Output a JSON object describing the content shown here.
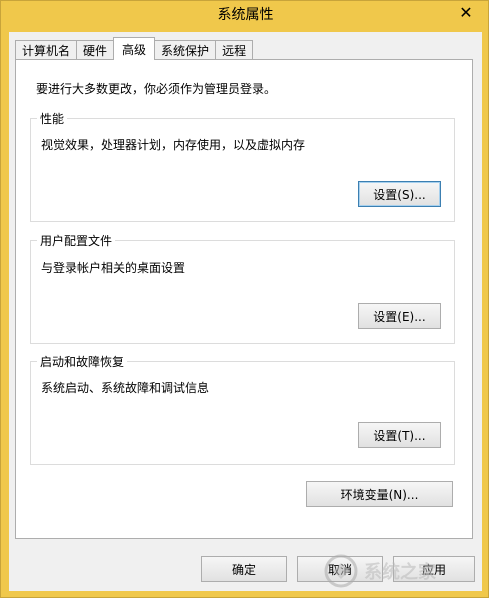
{
  "window": {
    "title": "系统属性",
    "close_glyph": "✕"
  },
  "tabs": [
    {
      "label": "计算机名",
      "active": false
    },
    {
      "label": "硬件",
      "active": false
    },
    {
      "label": "高级",
      "active": true
    },
    {
      "label": "系统保护",
      "active": false
    },
    {
      "label": "远程",
      "active": false
    }
  ],
  "panel": {
    "intro": "要进行大多数更改，你必须作为管理员登录。",
    "performance": {
      "title": "性能",
      "description": "视觉效果，处理器计划，内存使用，以及虚拟内存",
      "button": "设置(S)..."
    },
    "user_profiles": {
      "title": "用户配置文件",
      "description": "与登录帐户相关的桌面设置",
      "button": "设置(E)..."
    },
    "startup_recovery": {
      "title": "启动和故障恢复",
      "description": "系统启动、系统故障和调试信息",
      "button": "设置(T)..."
    },
    "env_button": "环境变量(N)..."
  },
  "footer": {
    "ok": "确定",
    "cancel": "取消",
    "apply": "应用"
  },
  "watermark": {
    "icon": "logo-icon",
    "text": "系统之家"
  },
  "colors": {
    "titlebar": "#f0c84b",
    "dialog_bg": "#f0f0f0",
    "panel_bg": "#ffffff"
  }
}
